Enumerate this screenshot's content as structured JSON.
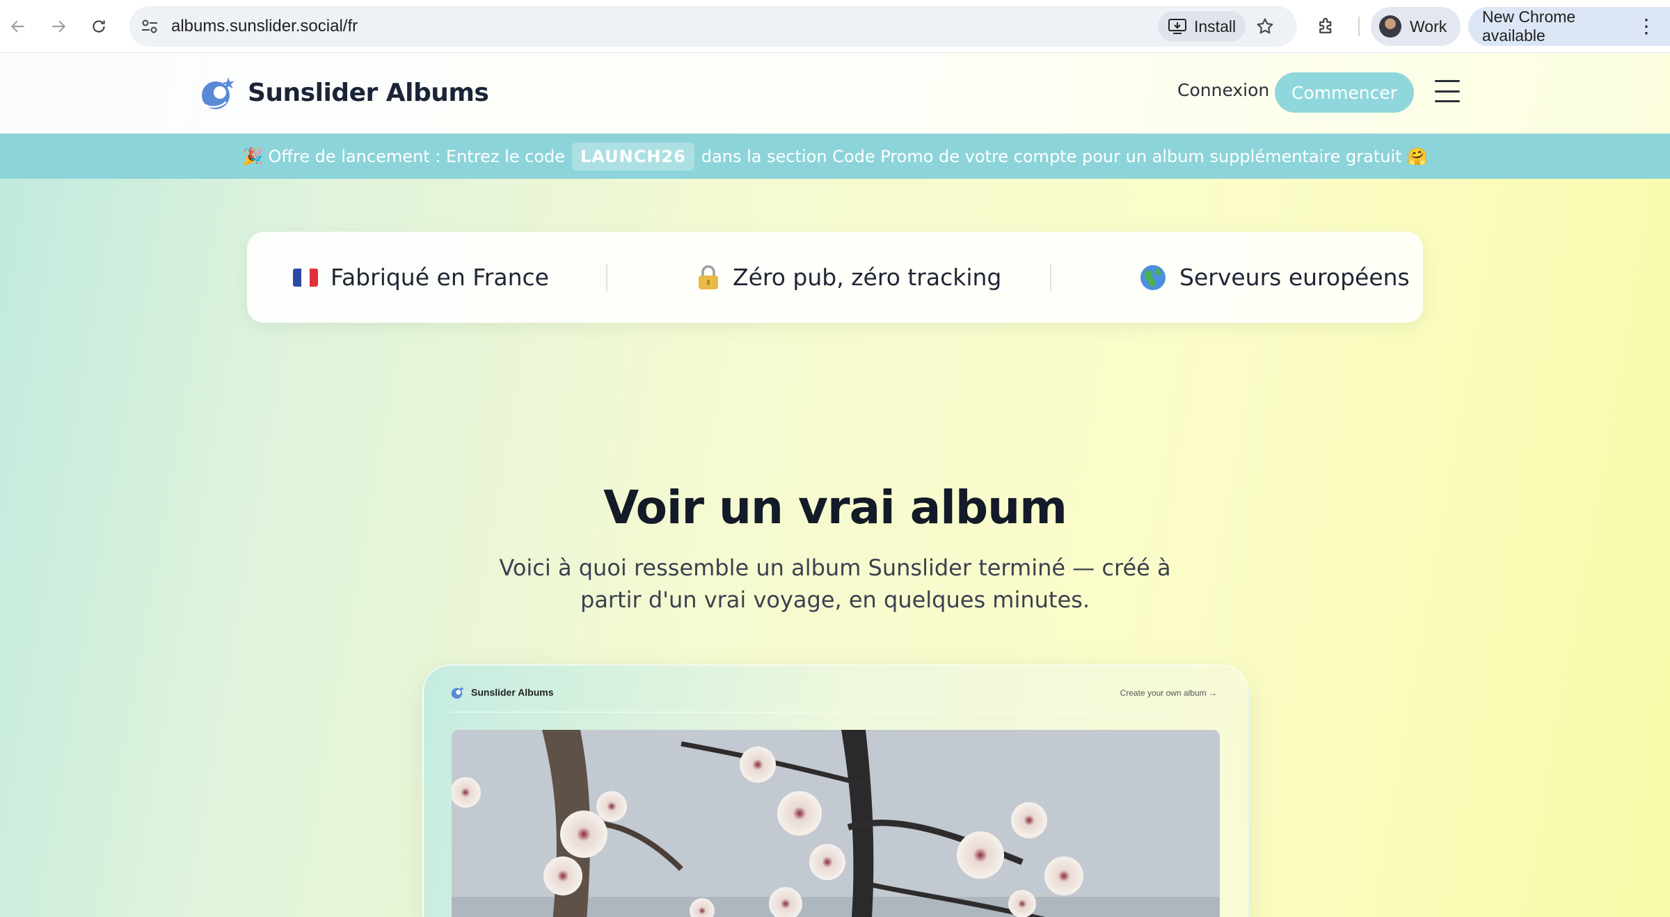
{
  "browser": {
    "url": "albums.sunslider.social/fr",
    "install_label": "Install",
    "profile_label": "Work",
    "update_label": "New Chrome available"
  },
  "header": {
    "brand_name": "Sunslider Albums",
    "login_label": "Connexion",
    "start_label": "Commencer"
  },
  "promo": {
    "prefix": "🎉 Offre de lancement : Entrez le code",
    "code": "LAUNCH26",
    "suffix": "dans la section Code Promo de votre compte pour un album supplémentaire gratuit 🤗"
  },
  "trust": {
    "items": [
      {
        "label": "Fabriqué en France",
        "icon": "france-flag-icon"
      },
      {
        "label": "Zéro pub, zéro tracking",
        "icon": "lock-icon"
      },
      {
        "label": "Serveurs européens",
        "icon": "globe-icon"
      }
    ]
  },
  "demo": {
    "title": "Voir un vrai album",
    "subtitle": "Voici à quoi ressemble un album Sunslider terminé — créé à partir d'un vrai voyage, en quelques minutes.",
    "preview": {
      "brand_name": "Sunslider Albums",
      "cta": "Create your own album →"
    }
  },
  "colors": {
    "accent": "#8cd4d9",
    "button": "#8fd7dc",
    "text_dark": "#131a28"
  }
}
